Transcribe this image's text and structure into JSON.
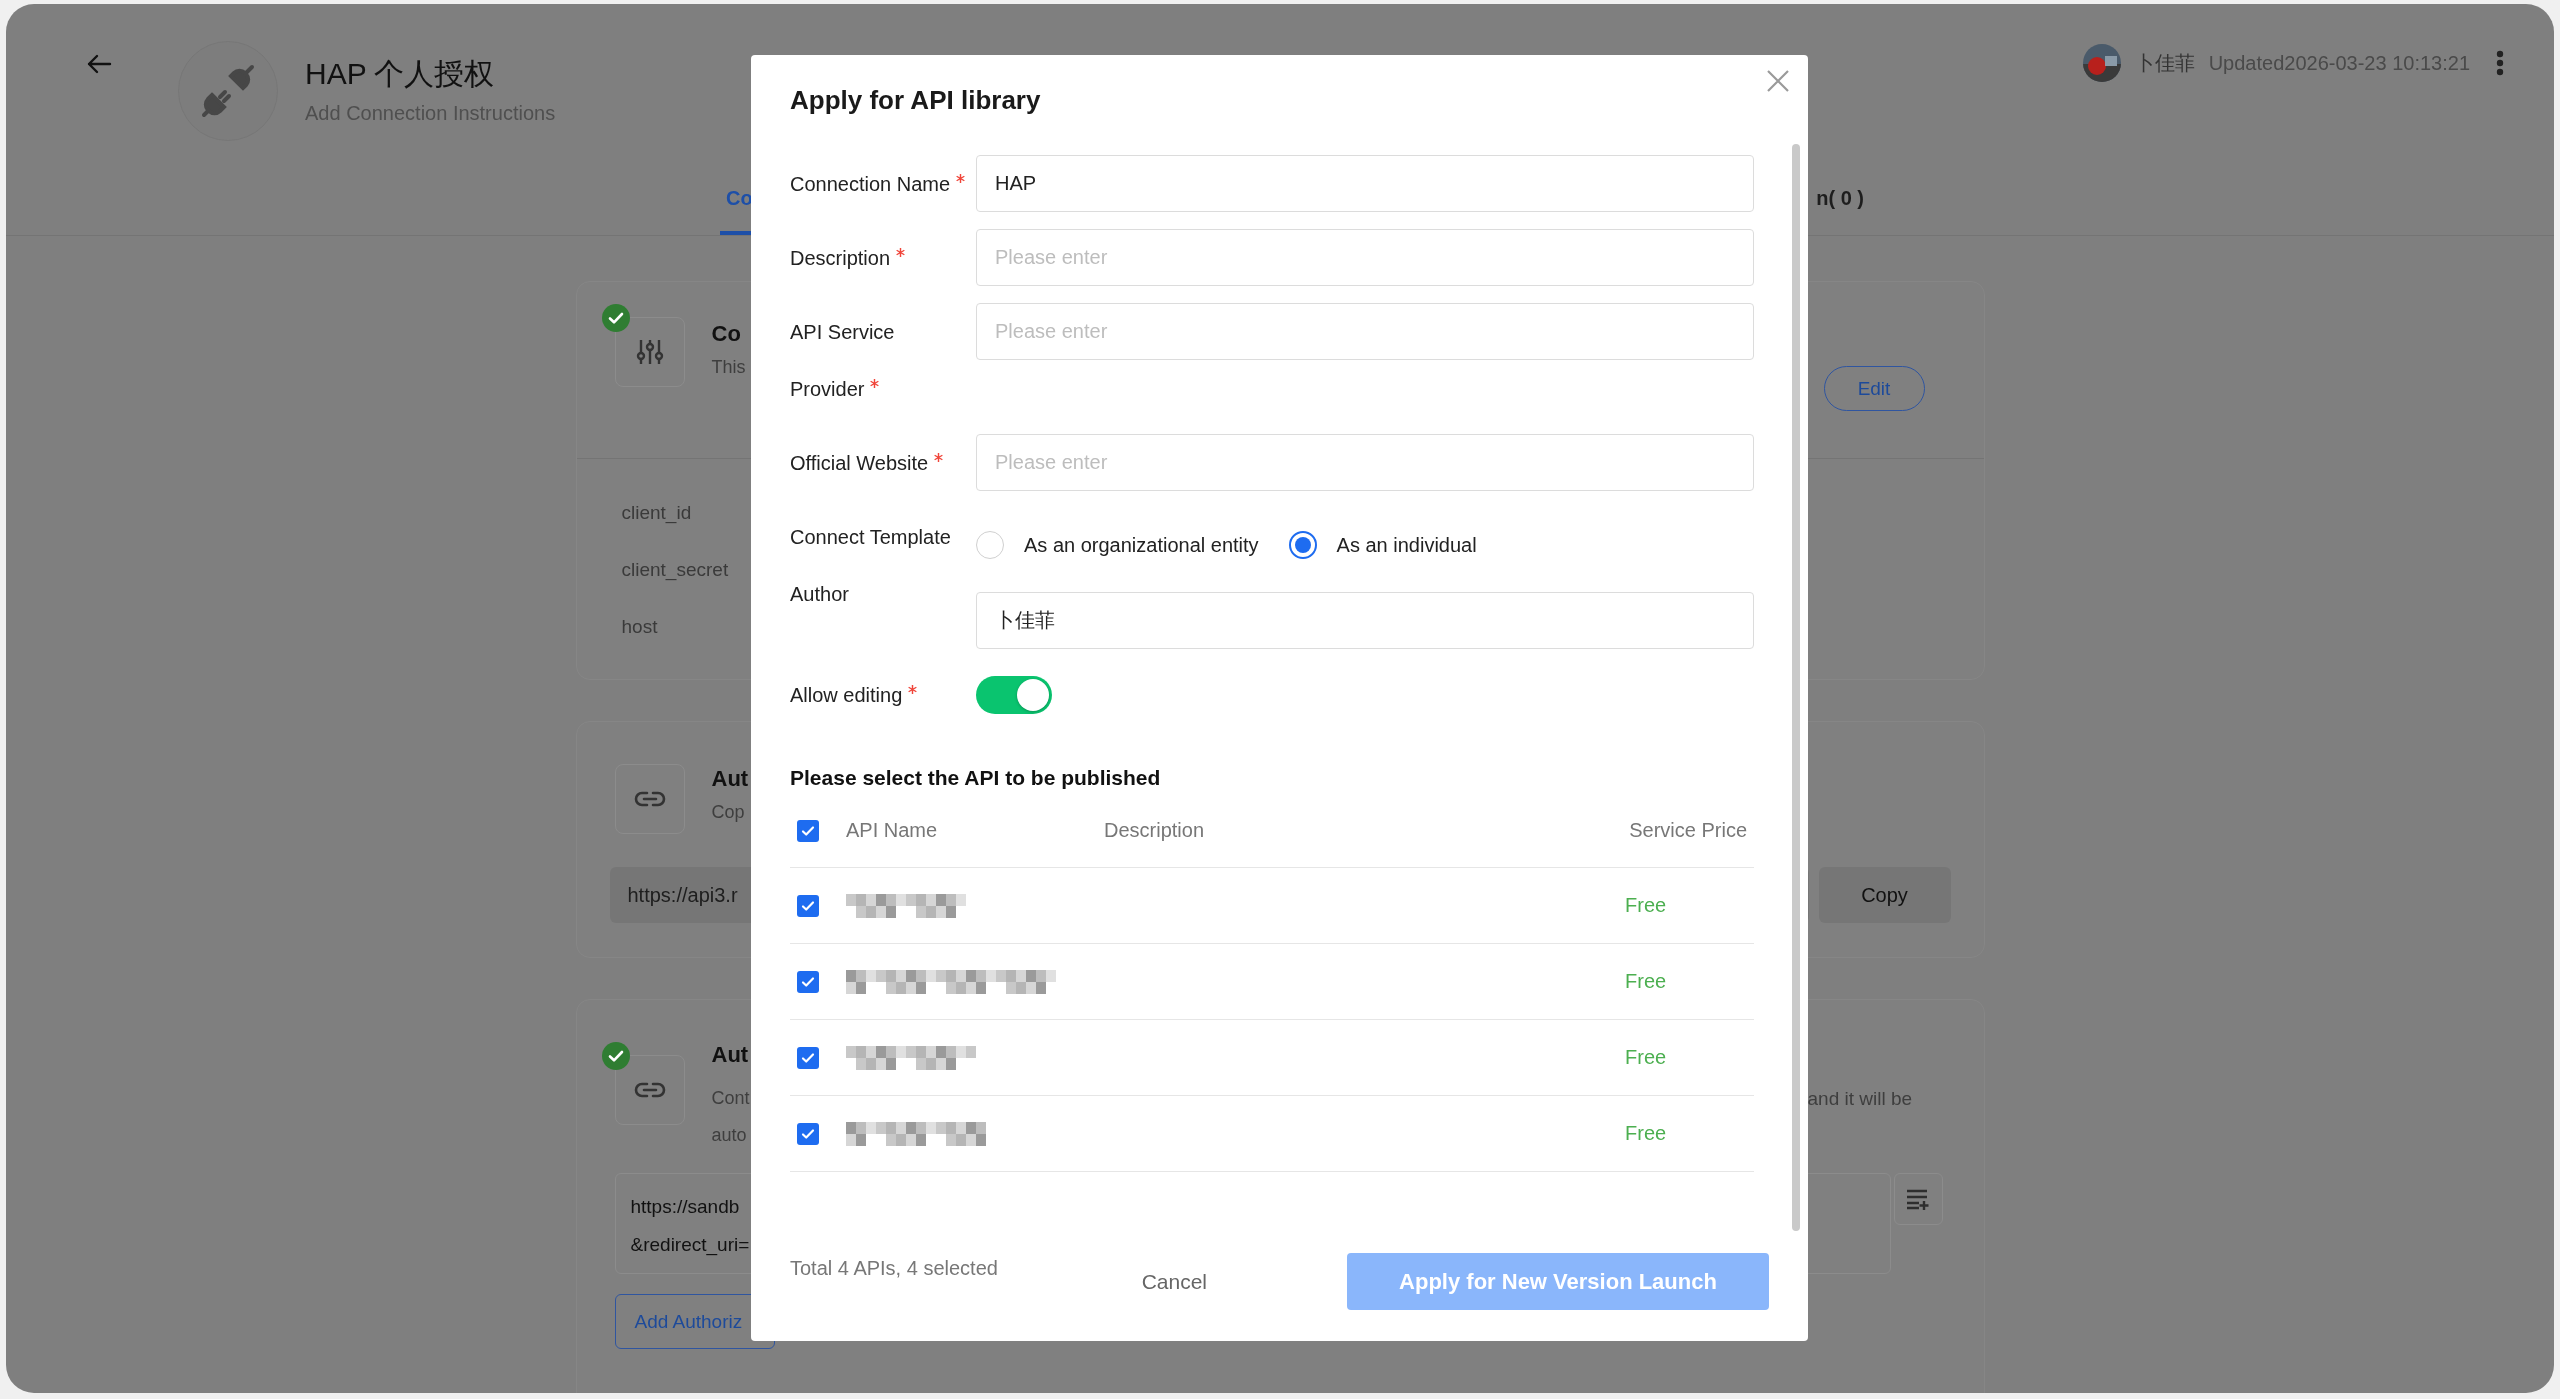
{
  "header": {
    "title": "HAP 个人授权",
    "subtitle": "Add Connection Instructions",
    "user": "卜佳菲",
    "updated": "Updated2026-03-23 10:13:21"
  },
  "tabs": [
    {
      "label": "Co",
      "selected": true
    },
    {
      "label": "n( 0 )",
      "selected": false
    }
  ],
  "cards": [
    {
      "kind": "params",
      "verified": true,
      "title": "Co",
      "description": "This",
      "action": "Edit",
      "params": [
        "client_id",
        "client_secret",
        "host"
      ]
    },
    {
      "kind": "url",
      "verified": false,
      "title": "Aut",
      "description": "Cop",
      "url": "https://api3.r",
      "action": "Copy"
    },
    {
      "kind": "redirect",
      "verified": true,
      "title": "Aut",
      "description_lines": [
        "Cont",
        "auto"
      ],
      "description_tail": "and it will be",
      "url_lines": [
        "https://sandb",
        "&redirect_uri="
      ],
      "action": "Add Authoriz"
    }
  ],
  "dialog": {
    "title": "Apply for API library",
    "fields": [
      {
        "kind": "text",
        "label": "Connection Name",
        "required": true,
        "value": "HAP"
      },
      {
        "kind": "text",
        "label": "Description",
        "required": true,
        "placeholder": "Please enter"
      },
      {
        "kind": "text",
        "label": "API Service",
        "placeholder": "Please enter"
      },
      {
        "kind": "label",
        "label": "Provider",
        "required": true
      },
      {
        "kind": "text",
        "label": "Official Website",
        "required": true,
        "placeholder": "Please enter"
      },
      {
        "kind": "radio",
        "label": "Connect Template",
        "options": [
          {
            "label": "As an organizational entity",
            "selected": false
          },
          {
            "label": "As an individual",
            "selected": true
          }
        ]
      },
      {
        "kind": "stacked",
        "label": "Author",
        "value": "卜佳菲"
      },
      {
        "kind": "switch",
        "label": "Allow editing",
        "required": true,
        "on": true
      }
    ],
    "section_title": "Please select the API to be published",
    "table": {
      "all_checked": true,
      "columns": [
        "API Name",
        "Description",
        "Service Price"
      ],
      "rows": [
        {
          "checked": true,
          "price": "Free"
        },
        {
          "checked": true,
          "price": "Free"
        },
        {
          "checked": true,
          "price": "Free"
        },
        {
          "checked": true,
          "price": "Free"
        }
      ]
    },
    "summary": "Total 4 APIs, 4 selected",
    "cancel": "Cancel",
    "submit": {
      "label": "Apply for New Version Launch",
      "disabled": true
    }
  }
}
